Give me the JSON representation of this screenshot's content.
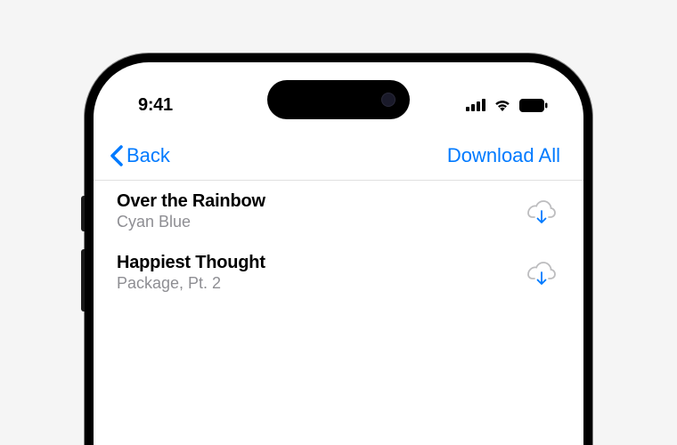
{
  "status": {
    "time": "9:41"
  },
  "nav": {
    "back_label": "Back",
    "action_label": "Download All"
  },
  "list": {
    "items": [
      {
        "title": "Over the Rainbow",
        "subtitle": "Cyan Blue"
      },
      {
        "title": "Happiest Thought",
        "subtitle": "Package, Pt. 2"
      }
    ]
  },
  "colors": {
    "accent": "#007aff",
    "secondary_text": "#8e8e93"
  }
}
